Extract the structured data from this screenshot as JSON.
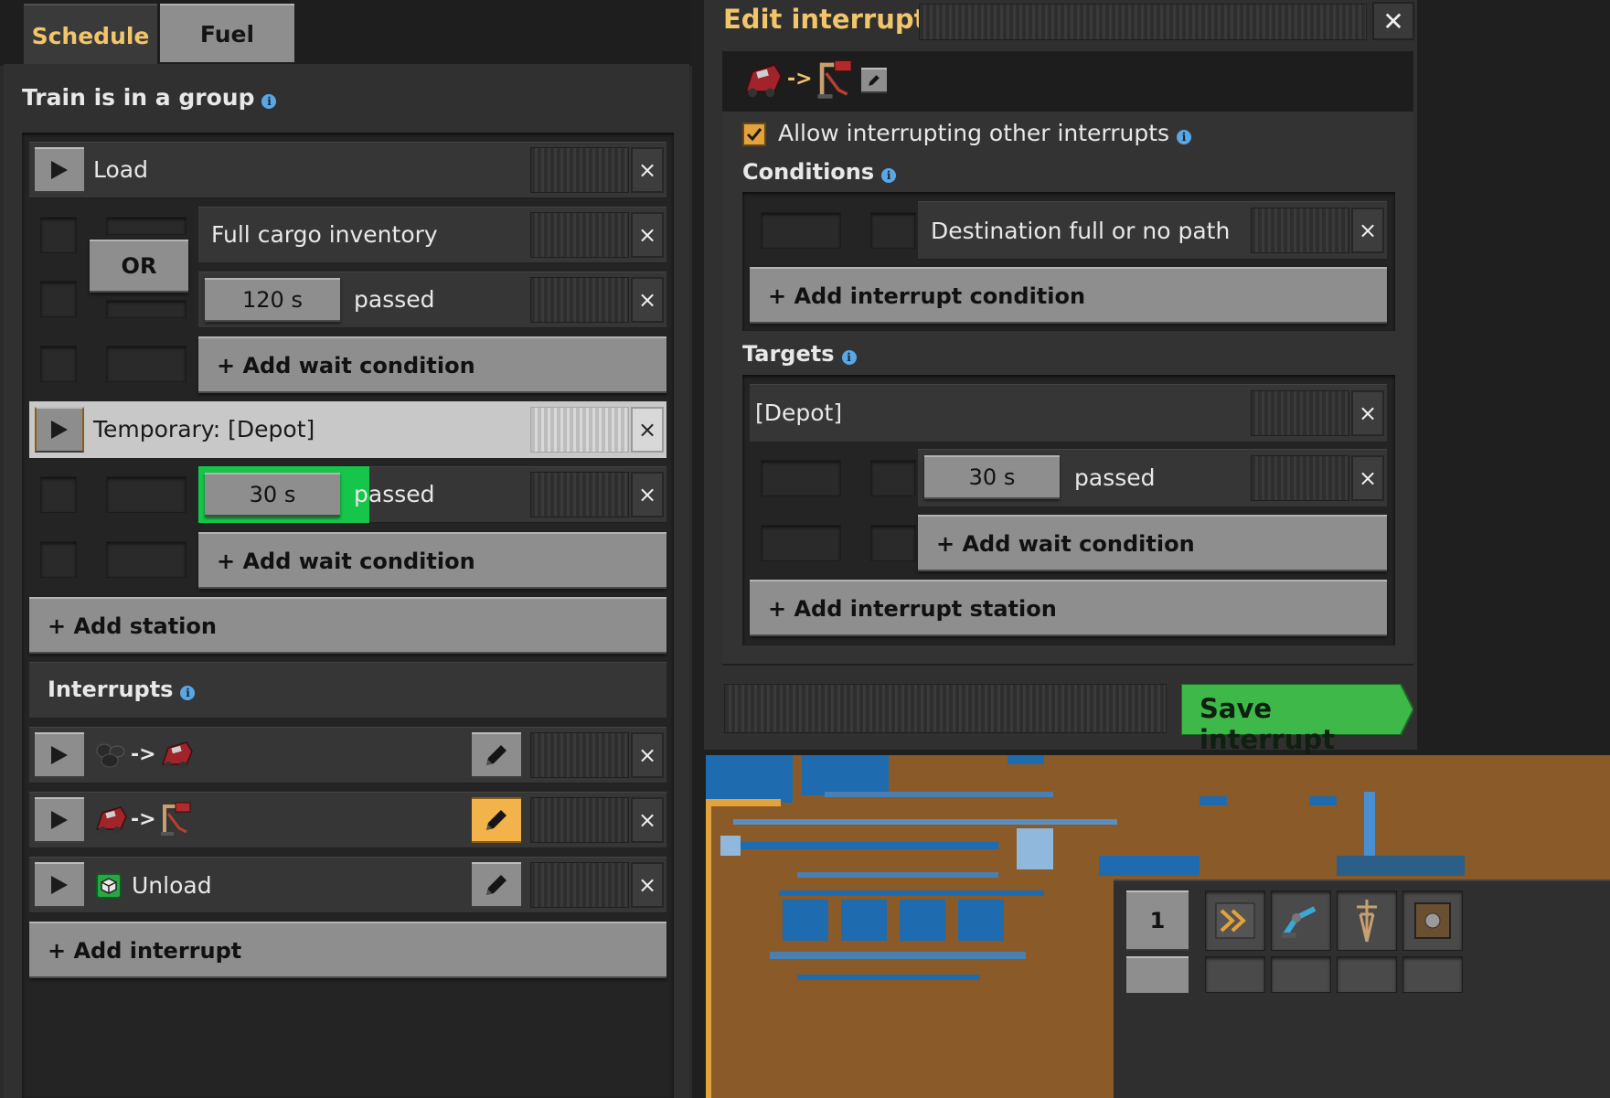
{
  "schedule_panel": {
    "tabs": [
      {
        "label": "Schedule",
        "active": true
      },
      {
        "label": "Fuel",
        "active": false
      }
    ],
    "group_label": "Train is in a group",
    "stations": [
      {
        "name": "Load",
        "conditions": [
          {
            "text": "Full cargo inventory"
          },
          {
            "value": "120 s",
            "suffix": "passed"
          }
        ],
        "combinator": "OR",
        "add_condition_label": "+ Add wait condition"
      },
      {
        "name": "Temporary: [Depot]",
        "active": true,
        "conditions": [
          {
            "value": "30 s",
            "suffix": "passed",
            "progress": 0.5
          }
        ],
        "add_condition_label": "+ Add wait condition"
      }
    ],
    "add_station_label": "+ Add station",
    "interrupts_heading": "Interrupts",
    "interrupts": [
      {
        "from_icon": "coal-icon",
        "arrow": "->",
        "to_icon": "locomotive-icon"
      },
      {
        "from_icon": "locomotive-icon",
        "arrow": "->",
        "to_icon": "rail-signal-icon",
        "editing": true
      },
      {
        "icon": "processor-chip-icon",
        "label": "Unload"
      }
    ],
    "add_interrupt_label": "+ Add interrupt",
    "close_symbol": "×"
  },
  "edit_interrupt": {
    "title": "Edit interrupt",
    "close_symbol": "✕",
    "name_arrow": "->",
    "allow_interrupting_label": "Allow interrupting other interrupts",
    "allow_interrupting_checked": true,
    "conditions_heading": "Conditions",
    "conditions": [
      {
        "text": "Destination full or no path"
      }
    ],
    "add_interrupt_condition_label": "+ Add interrupt condition",
    "targets_heading": "Targets",
    "targets": [
      {
        "name": "[Depot]",
        "conditions": [
          {
            "value": "30 s",
            "suffix": "passed"
          }
        ],
        "add_condition_label": "+ Add wait condition"
      }
    ],
    "add_interrupt_station_label": "+ Add interrupt station",
    "save_label": "Save interrupt"
  },
  "hotbar": {
    "slot_number": "1"
  },
  "colors": {
    "accent_orange": "#f2b34a",
    "save_green": "#3fb84a",
    "progress_green": "#16c64a",
    "map_water": "#1f6bb0",
    "map_land": "#8a5a28"
  }
}
